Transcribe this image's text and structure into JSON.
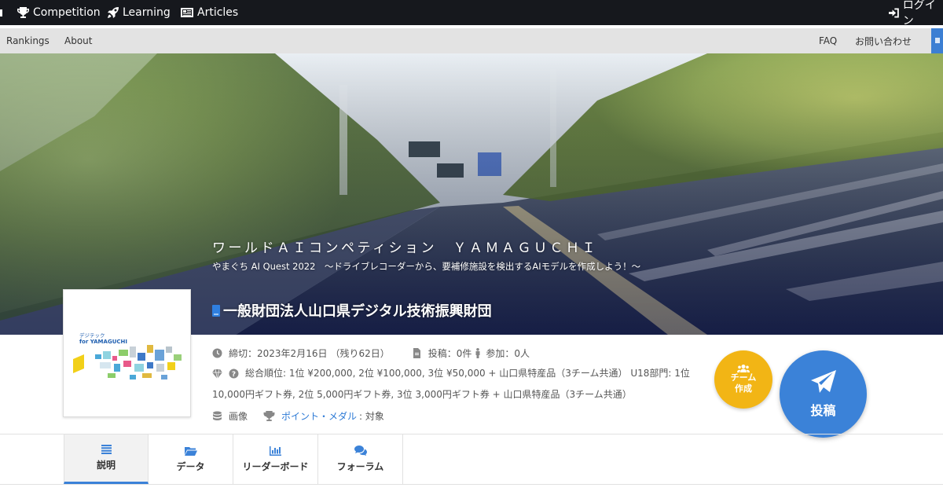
{
  "topnav": {
    "competition": "Competition",
    "learning": "Learning",
    "articles": "Articles",
    "login": "ログイン"
  },
  "subnav": {
    "rankings": "Rankings",
    "about": "About",
    "faq": "FAQ",
    "contact": "お問い合わせ"
  },
  "hero": {
    "title": "ワールドＡＩコンペティション　ＹＡＭＡＧＵＣＨＩ",
    "subtitle": "やまぐち AI Quest 2022　～ドライブレコーダーから、要補修施設を検出するAIモデルを作成しよう！～",
    "organizer": "一般財団法人山口県デジタル技術振興財団"
  },
  "logo": {
    "line1": "デジテック",
    "line2": "for YAMAGUCHI"
  },
  "info": {
    "deadline_label": "締切：",
    "deadline": "2023年2月16日",
    "remaining": "（残り62日）",
    "submissions_label": "投稿：",
    "submissions": "0件",
    "participants_label": "参加：",
    "participants": "0人",
    "prize_line1": "総合順位: 1位 ¥200,000, 2位 ¥100,000, 3位 ¥50,000 + 山口県特産品（3チーム共通） U18部門: 1位",
    "prize_line2": "10,000円ギフト券, 2位 5,000円ギフト券, 3位 3,000円ギフト券 + 山口県特産品（3チーム共通）",
    "data_type": "画像",
    "points_link": "ポイント・メダル",
    "points_suffix": ": 対象"
  },
  "buttons": {
    "team_line1": "チーム",
    "team_line2": "作成",
    "post": "投稿"
  },
  "tabs": [
    {
      "label": "説明",
      "icon": "list-icon",
      "active": true
    },
    {
      "label": "データ",
      "icon": "folder-icon",
      "active": false
    },
    {
      "label": "リーダーボード",
      "icon": "bar-chart-icon",
      "active": false
    },
    {
      "label": "フォーラム",
      "icon": "comments-icon",
      "active": false
    }
  ],
  "colors": {
    "topnav_bg": "#16181d",
    "accent": "#3b82d8",
    "team_button": "#f2b515"
  }
}
